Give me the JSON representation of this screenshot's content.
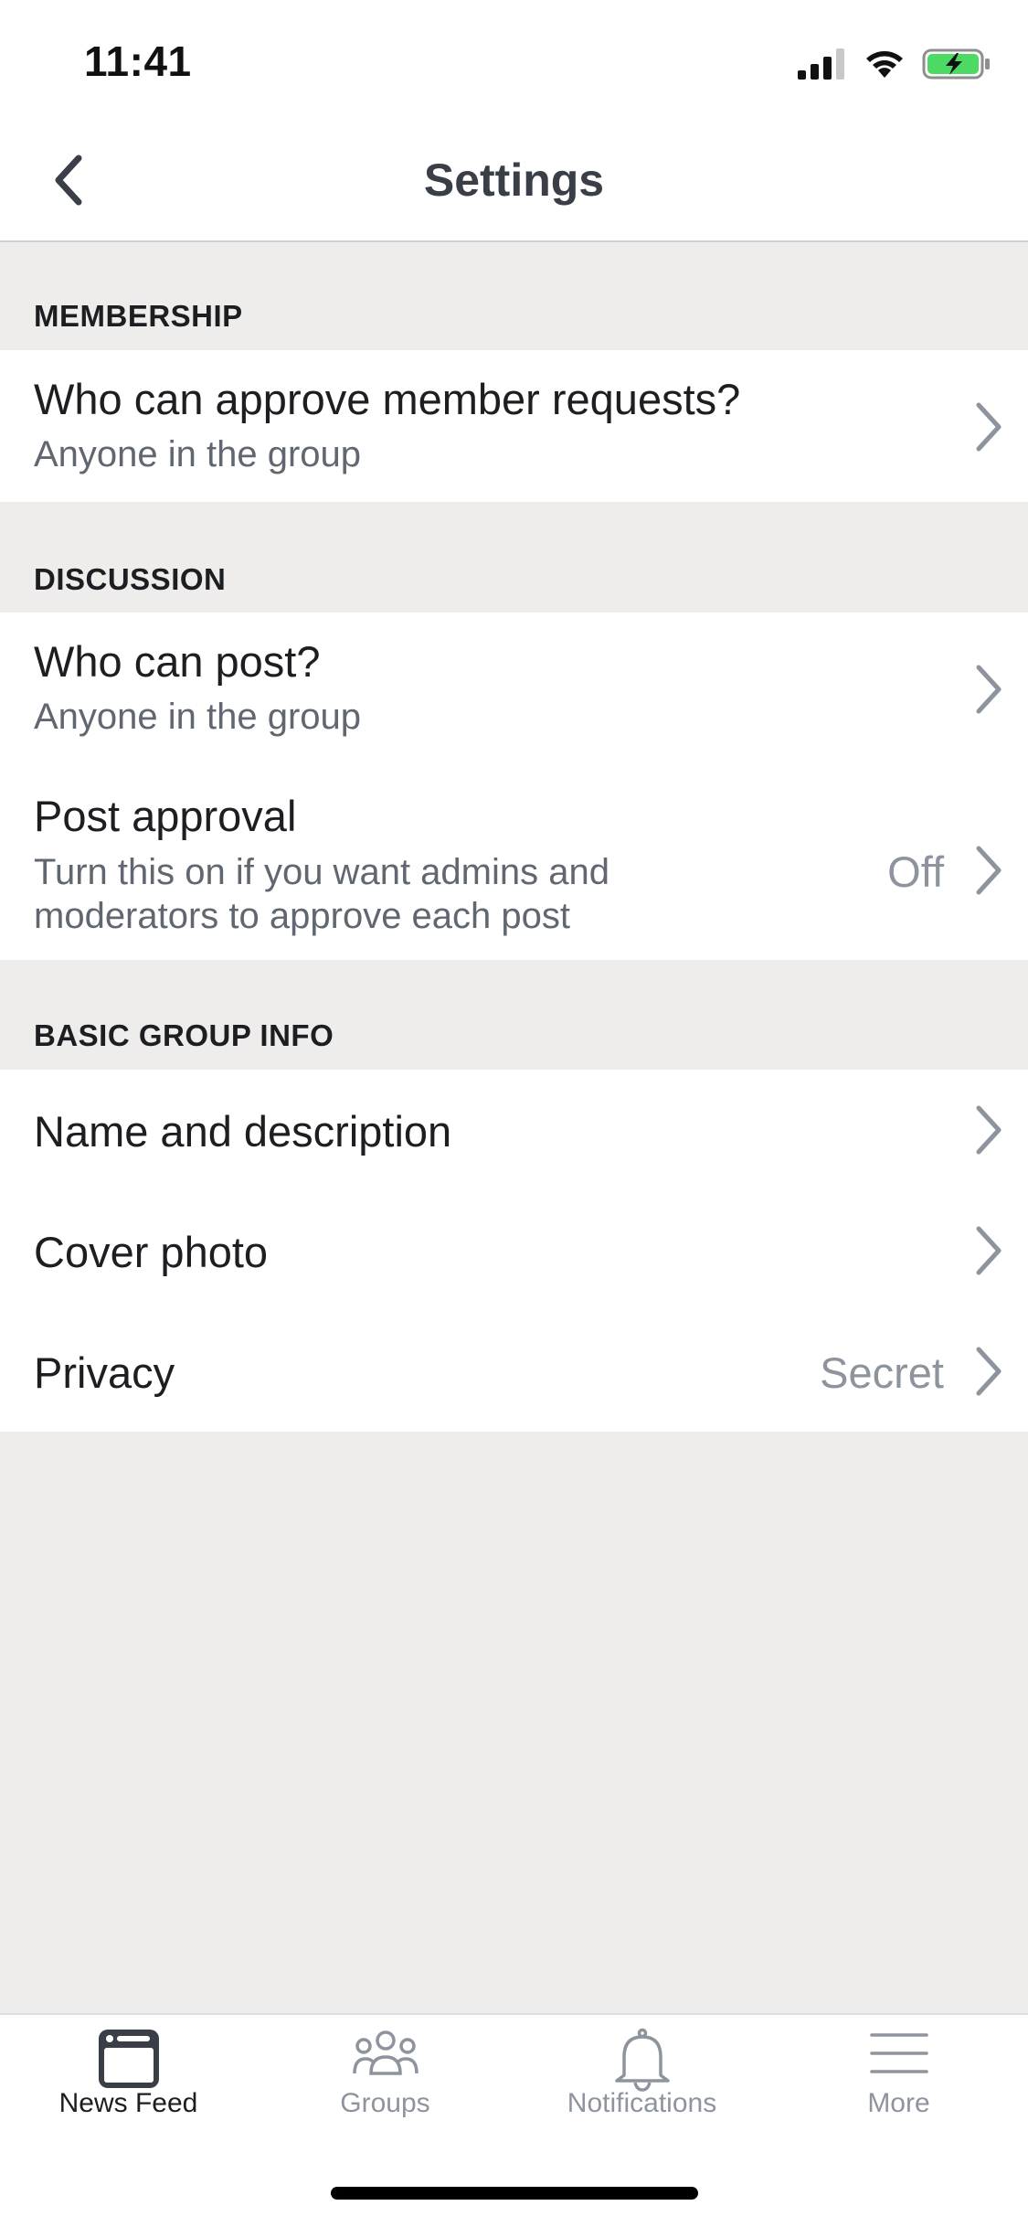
{
  "status_bar": {
    "time": "11:41"
  },
  "header": {
    "title": "Settings"
  },
  "sections": [
    {
      "title": "MEMBERSHIP",
      "rows": [
        {
          "title": "Who can approve member requests?",
          "subtitle": "Anyone in the group"
        }
      ]
    },
    {
      "title": "DISCUSSION",
      "rows": [
        {
          "title": "Who can post?",
          "subtitle": "Anyone in the group"
        },
        {
          "title": "Post approval",
          "subtitle": "Turn this on if you want admins and moderators to approve each post",
          "value": "Off"
        }
      ]
    },
    {
      "title": "BASIC GROUP INFO",
      "rows": [
        {
          "title": "Name and description"
        },
        {
          "title": "Cover photo"
        },
        {
          "title": "Privacy",
          "value": "Secret"
        }
      ]
    }
  ],
  "tabs": [
    {
      "label": "News Feed",
      "icon": "news-feed-icon",
      "active": true
    },
    {
      "label": "Groups",
      "icon": "groups-icon",
      "active": false
    },
    {
      "label": "Notifications",
      "icon": "bell-icon",
      "active": false
    },
    {
      "label": "More",
      "icon": "menu-icon",
      "active": false
    }
  ],
  "colors": {
    "background": "#eeedeb",
    "battery_green": "#4cd964",
    "active_tab": "#1c1e21",
    "inactive_tab": "#8d949e"
  }
}
